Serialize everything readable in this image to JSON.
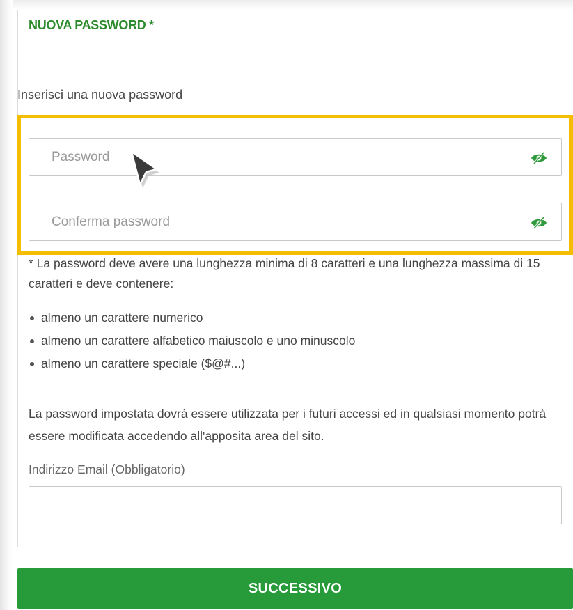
{
  "form": {
    "section_title": "NUOVA PASSWORD *",
    "subtitle": "Inserisci una nuova password",
    "password_placeholder": "Password",
    "confirm_placeholder": "Conferma password",
    "toggle_icon": "eye-slash-icon",
    "requirements_note": "*  La password deve avere una lunghezza minima di 8 caratteri e una lunghezza massima di 15 caratteri e deve contenere:",
    "requirements": [
      "almeno un carattere numerico",
      "almeno un carattere alfabetico maiuscolo e uno minuscolo",
      "almeno un carattere speciale ($@#...)"
    ],
    "info_text": "La password impostata dovrà essere utilizzata per i futuri accessi ed in qualsiasi momento potrà essere modificata accedendo all'apposita area del sito.",
    "email_label": "Indirizzo Email (Obbligatorio)",
    "email_value": "",
    "submit_label": "SUCCESSIVO"
  },
  "colors": {
    "accent_green": "#2d8a2d",
    "button_green": "#279a3a",
    "highlight_yellow": "#f5bd00"
  }
}
